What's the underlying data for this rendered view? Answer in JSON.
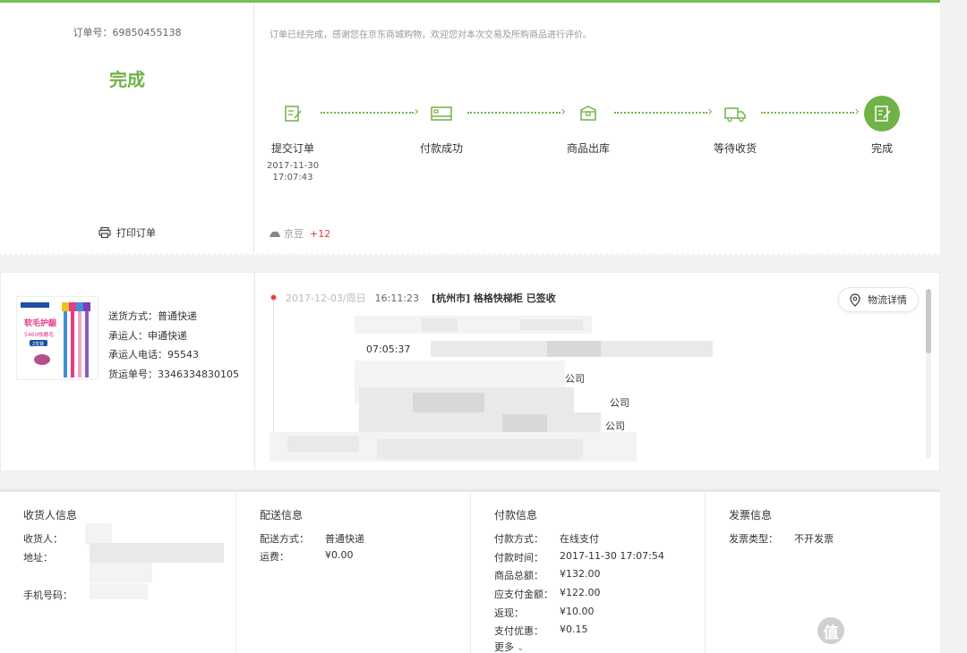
{
  "order": {
    "order_no": "订单号：69850455138",
    "status": "完成",
    "message": "订单已经完成，感谢您在京东商城购物，欢迎您对本次交易及所购商品进行评价。",
    "print_label": "打印订单",
    "jingdou_label": "京豆",
    "jingdou_value": "+12",
    "accent_color": "#71b247",
    "steps": [
      {
        "label": "提交订单",
        "date": "2017-11-30",
        "time": "17:07:43"
      },
      {
        "label": "付款成功",
        "date": "",
        "time": ""
      },
      {
        "label": "商品出库",
        "date": "",
        "time": ""
      },
      {
        "label": "等待收货",
        "date": "",
        "time": ""
      },
      {
        "label": "完成",
        "date": "",
        "time": ""
      }
    ]
  },
  "shipping": {
    "product_thumb_text": "软毛护龈",
    "product_thumb_sub": "5460根磨毛",
    "product_thumb_tag": "2支装",
    "rows": [
      "送货方式：普通快递",
      "承运人：申通快递",
      "承运人电话：95543",
      "货运单号：3346334830105"
    ],
    "track": {
      "latest_date": "2017-12-03/周日",
      "latest_time": "16:11:23",
      "latest_event": "[杭州市] 格格快梯柜 已签收",
      "time2": "07:05:37",
      "frag1": "公司",
      "frag2": "公司",
      "frag3": "公司"
    },
    "logistics_button": "物流详情"
  },
  "info": {
    "receiver": {
      "title": "收货人信息",
      "name_label": "收货人：",
      "address_label": "地址：",
      "phone_label": "手机号码："
    },
    "delivery": {
      "title": "配送信息",
      "rows": [
        {
          "k": "配送方式：",
          "v": "普通快递"
        },
        {
          "k": "运费：",
          "v": "¥0.00"
        }
      ]
    },
    "payment": {
      "title": "付款信息",
      "rows": [
        {
          "k": "付款方式：",
          "v": "在线支付"
        },
        {
          "k": "付款时间：",
          "v": "2017-11-30 17:07:54"
        },
        {
          "k": "商品总额：",
          "v": "¥132.00"
        },
        {
          "k": "应支付金额：",
          "v": "¥122.00"
        },
        {
          "k": "返现：",
          "v": "¥10.00"
        },
        {
          "k": "支付优惠：",
          "v": "¥0.15"
        }
      ],
      "more": "更多"
    },
    "invoice": {
      "title": "发票信息",
      "rows": [
        {
          "k": "发票类型：",
          "v": "不开发票"
        }
      ]
    }
  },
  "watermark": "什么值得买"
}
